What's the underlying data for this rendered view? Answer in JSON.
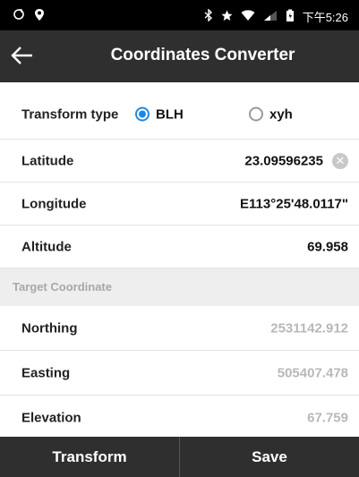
{
  "status_bar": {
    "time": "下午5:26"
  },
  "app_bar": {
    "title": "Coordinates Converter"
  },
  "transform": {
    "label": "Transform type",
    "options": [
      {
        "label": "BLH",
        "selected": true
      },
      {
        "label": "xyh",
        "selected": false
      }
    ]
  },
  "inputs": {
    "latitude": {
      "label": "Latitude",
      "value": "23.09596235"
    },
    "longitude": {
      "label": "Longitude",
      "value": "E113°25'48.0117\""
    },
    "altitude": {
      "label": "Altitude",
      "value": "69.958"
    }
  },
  "target": {
    "header": "Target Coordinate",
    "northing": {
      "label": "Northing",
      "value": "2531142.912"
    },
    "easting": {
      "label": "Easting",
      "value": "505407.478"
    },
    "elevation": {
      "label": "Elevation",
      "value": "67.759"
    }
  },
  "actions": {
    "transform_label": "Transform",
    "save_label": "Save"
  },
  "colors": {
    "accent": "#1e88e5",
    "bar": "#2f2f2f",
    "muted_value": "#b8b8b8"
  }
}
